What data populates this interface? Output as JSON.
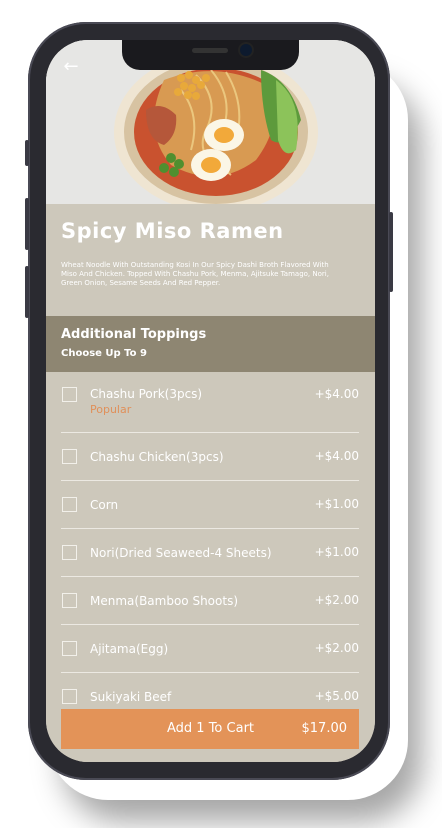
{
  "dish": {
    "title": "Spicy Miso Ramen",
    "description": "Wheat Noodle With Outstanding Kosi In Our Spicy Dashi Broth Flavored With Miso And Chicken. Topped With Chashu Pork, Menma, Ajitsuke Tamago, Nori, Green Onion, Sesame Seeds And Red Pepper."
  },
  "nav": {
    "back_icon": "arrow-left-icon",
    "back_glyph": "←"
  },
  "toppings": {
    "title": "Additional Toppings",
    "subtitle": "Choose Up To 9",
    "items": [
      {
        "name": "Chashu Pork(3pcs)",
        "price": "+$4.00",
        "badge": "Popular"
      },
      {
        "name": "Chashu Chicken(3pcs)",
        "price": "+$4.00"
      },
      {
        "name": "Corn",
        "price": "+$1.00"
      },
      {
        "name": "Nori(Dried Seaweed-4 Sheets)",
        "price": "+$1.00"
      },
      {
        "name": "Menma(Bamboo Shoots)",
        "price": "+$2.00"
      },
      {
        "name": "Ajitama(Egg)",
        "price": "+$2.00"
      },
      {
        "name": "Sukiyaki Beef",
        "price": "+$5.00"
      }
    ]
  },
  "cart": {
    "label": "Add 1 To Cart",
    "total": "$17.00"
  },
  "colors": {
    "background": "#cdc8bb",
    "header_band": "#8e8672",
    "accent": "#e39358",
    "badge": "#e0905a"
  }
}
